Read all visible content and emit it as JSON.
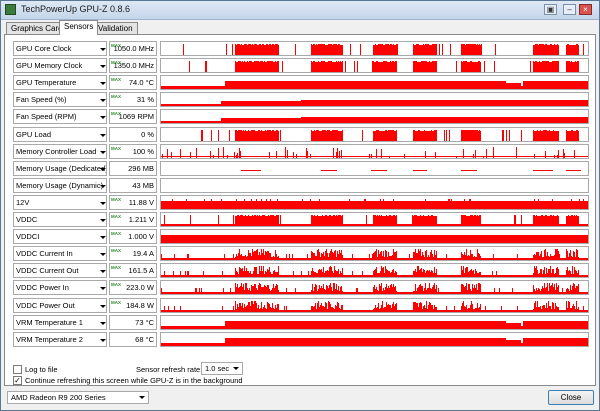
{
  "window": {
    "title": "TechPowerUp GPU-Z 0.8.6",
    "buttons": {
      "camera": "▣",
      "minimize": "–",
      "close": "×"
    }
  },
  "tabs": [
    {
      "label": "Graphics Card"
    },
    {
      "label": "Sensors"
    },
    {
      "label": "Validation"
    }
  ],
  "active_tab": "Sensors",
  "max_tag": "MAX",
  "sensors": [
    {
      "name": "GPU Core Clock",
      "value": "1050.0 MHz",
      "max": true,
      "style": "blocks"
    },
    {
      "name": "GPU Memory Clock",
      "value": "1350.0 MHz",
      "max": true,
      "style": "blocks"
    },
    {
      "name": "GPU Temperature",
      "value": "74.0 °C",
      "max": true,
      "style": "smooth"
    },
    {
      "name": "Fan Speed (%)",
      "value": "31 %",
      "max": true,
      "style": "smooth-low"
    },
    {
      "name": "Fan Speed (RPM)",
      "value": "1069 RPM",
      "max": true,
      "style": "smooth-low"
    },
    {
      "name": "GPU Load",
      "value": "0 %",
      "max": false,
      "style": "blocks"
    },
    {
      "name": "Memory Controller Load",
      "value": "100 %",
      "max": true,
      "style": "sparse"
    },
    {
      "name": "Memory Usage (Dedicated)",
      "value": "296 MB",
      "max": false,
      "style": "dashes"
    },
    {
      "name": "Memory Usage (Dynamic)",
      "value": "43 MB",
      "max": false,
      "style": "none"
    },
    {
      "name": "12V",
      "value": "11.88 V",
      "max": true,
      "style": "full-base"
    },
    {
      "name": "VDDC",
      "value": "1.211 V",
      "max": true,
      "style": "blocks-base"
    },
    {
      "name": "VDDCI",
      "value": "1.000 V",
      "max": true,
      "style": "full"
    },
    {
      "name": "VDDC Current In",
      "value": "19.4 A",
      "max": true,
      "style": "spiky"
    },
    {
      "name": "VDDC Current Out",
      "value": "161.5 A",
      "max": true,
      "style": "spiky"
    },
    {
      "name": "VDDC Power In",
      "value": "223.0 W",
      "max": true,
      "style": "spiky"
    },
    {
      "name": "VDDC Power Out",
      "value": "184.8 W",
      "max": true,
      "style": "spiky"
    },
    {
      "name": "VRM Temperature 1",
      "value": "73 °C",
      "max": false,
      "style": "smooth"
    },
    {
      "name": "VRM Temperature 2",
      "value": "68 °C",
      "max": false,
      "style": "smooth"
    }
  ],
  "options": {
    "log_to_file": {
      "label": "Log to file",
      "checked": false
    },
    "continue_refresh": {
      "label": "Continue refreshing this screen while GPU-Z is in the background",
      "checked": true
    },
    "refresh_rate_label": "Sensor refresh rate:",
    "refresh_rate_value": "1.0 sec",
    "check_mark": "✓"
  },
  "footer": {
    "device": "AMD Radeon R9 200 Series",
    "close_label": "Close"
  },
  "colors": {
    "graph": "#ff0000",
    "max_tag": "#2e8b2e",
    "window_border": "#5a7896"
  }
}
